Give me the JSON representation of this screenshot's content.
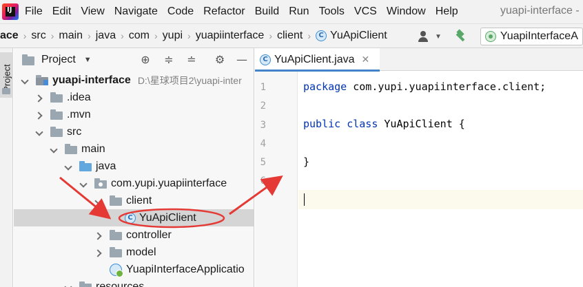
{
  "menubar": {
    "items": [
      "File",
      "Edit",
      "View",
      "Navigate",
      "Code",
      "Refactor",
      "Build",
      "Run",
      "Tools",
      "VCS",
      "Window",
      "Help"
    ],
    "window_title": "yuapi-interface - "
  },
  "navbar": {
    "breadcrumbs": [
      "ace",
      "src",
      "main",
      "java",
      "com",
      "yupi",
      "yuapiinterface",
      "client",
      "YuApiClient"
    ],
    "run_config": "YuapiInterfaceA"
  },
  "toolstrip": {
    "project_tab": "Project"
  },
  "project_panel": {
    "title": "Project",
    "tree": [
      {
        "label": "yuapi-interface",
        "path": "D:\\星球项目2\\yuapi-inter"
      },
      {
        "label": ".idea"
      },
      {
        "label": ".mvn"
      },
      {
        "label": "src"
      },
      {
        "label": "main"
      },
      {
        "label": "java"
      },
      {
        "label": "com.yupi.yuapiinterface"
      },
      {
        "label": "client"
      },
      {
        "label": "YuApiClient"
      },
      {
        "label": "controller"
      },
      {
        "label": "model"
      },
      {
        "label": "YuapiInterfaceApplicatio"
      },
      {
        "label": "resources"
      }
    ]
  },
  "editor": {
    "tab_label": "YuApiClient.java",
    "line_numbers": [
      "1",
      "2",
      "3",
      "4",
      "5",
      "6"
    ],
    "code": {
      "line1_kw": "package",
      "line1_rest": " com.yupi.yuapiinterface.client;",
      "line3_kw1": "public",
      "line3_kw2": "class",
      "line3_name": "YuApiClient",
      "line3_brace": " {",
      "line5": "}"
    }
  },
  "colors": {
    "keyword": "#0033b3",
    "annotation": "#e53935",
    "selection": "#d5d5d5",
    "tab_underline": "#4083c9"
  }
}
